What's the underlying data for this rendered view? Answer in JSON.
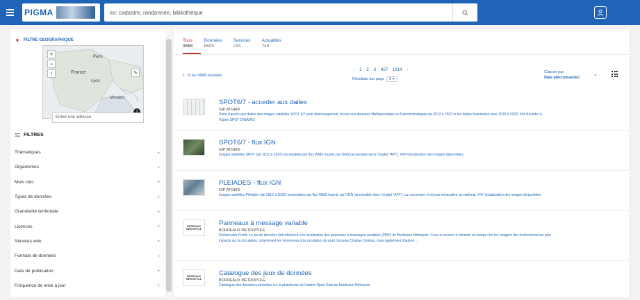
{
  "header": {
    "logo_text": "PIGMA",
    "search_placeholder": "ex: cadastre, randonnée, bibliothèque"
  },
  "sidebar": {
    "geo_filter_title": "FILTRE GEOGRAPHIQUE",
    "map_cities": [
      "Paris",
      "France",
      "Lyon",
      "Monaco"
    ],
    "address_placeholder": "Entrer une adresse",
    "filters_title": "FILTRES",
    "filters": [
      "Thématiques",
      "Organismes",
      "Mots clés",
      "Types de données",
      "Granularité territoriale",
      "Licences",
      "Services web",
      "Formats de données",
      "Date de publication",
      "Fréquence de mise à jour"
    ]
  },
  "main": {
    "tabs": [
      {
        "label": "Tous",
        "count": "9568"
      },
      {
        "label": "Données",
        "count": "8605"
      },
      {
        "label": "Services",
        "count": "215"
      },
      {
        "label": "Actualités",
        "count": "748"
      }
    ],
    "results_count": "1 - 5 sur 9568 résultats",
    "pagination": [
      "1",
      "2",
      "3",
      "957",
      "1914"
    ],
    "per_page_label": "Résultats par page",
    "per_page_value": "5",
    "sort_label": "Classer par",
    "sort_value": "Date (décroissante)",
    "results": [
      {
        "title": "SPOT6/7 - acceder aux dalles",
        "org": "GIP ATGERI",
        "desc": "Point d'accès aux dalles des images satellites SPOT 6/7 pour téléchargement. Accès aux données Multispectrales ou Panchromatiques de 2013 à 2023 et les dalles fusionnées pour 2020 à 2023. ### Accéder à l'Open SPOT DINAMIS"
      },
      {
        "title": "SPOT6/7 - flux IGN",
        "org": "GIP ATGERI",
        "desc": "Images satellites SPOT (de 2013 à 2023) accessibles par flux WMS fournis par l'IGN (accessible dans l'onglet \"API\"). ### Visualisation des images disponibles"
      },
      {
        "title": "PLEIADES - flux IGN",
        "org": "GIP ATGERI",
        "desc": "Images satellites Pléiades (de 2012 à 2022) accessibles par flux WMS fournis par l'IGN (accessible dans l'onglet \"API\"). La couverture n'est pas exhaustive au national. ### Visualisation des images disponibles"
      },
      {
        "title": "Panneaux à message variable",
        "org": "BORDEAUX METROPOLE",
        "desc": "Dictionnaire Public Le jeu de données fait référence à la localisation des panneaux à messages variables (PMV) de Bordeaux Métropole. Ceux-ci servent à informer en temps réel les usagers des évènements les plus impacts sur la circulation, notamment les fermetures à la circulation du pont Jacques Chaban Delmas, mais également d'autres ..."
      },
      {
        "title": "Catalogue des jeux de données",
        "org": "BORDEAUX METROPOLE",
        "desc": "Catalogue des données présentes sur la plateforme de l'atelier Open Data de Bordeaux Métropole"
      }
    ]
  }
}
